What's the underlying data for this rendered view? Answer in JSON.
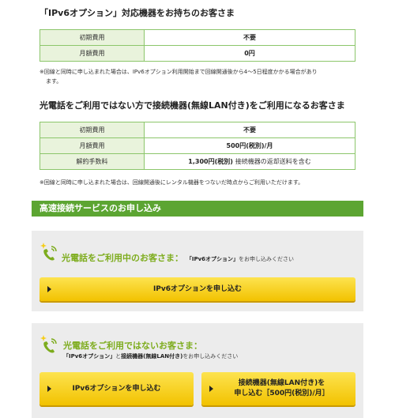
{
  "section1": {
    "title": "「IPv6オプション」対応機器をお持ちのお客さま",
    "rows": [
      {
        "label": "初期費用",
        "value": "不要"
      },
      {
        "label": "月額費用",
        "value": "0円"
      }
    ],
    "note_line1": "※回線と同時に申し込まれた場合は、IPv6オプション利用開始まで回線開通後から4～5日程度かかる場合があり",
    "note_line2": "ます。"
  },
  "section2": {
    "title": "光電話をご利用ではない方で接続機器(無線LAN付き)をご利用になるお客さま",
    "rows": [
      {
        "label": "初期費用",
        "value": "不要"
      },
      {
        "label": "月額費用",
        "value": "500円(税別)/月"
      },
      {
        "label": "解約手数料",
        "value": "1,300円(税別)",
        "value_sub": "接続機器の返却送料を含む"
      }
    ],
    "note": "※回線と同時に申し込まれた場合は、回線開通後にレンタル機器をつないだ時点からご利用いただけます。"
  },
  "apply_bar": "高速接続サービスのお申し込み",
  "card1": {
    "heading": "光電話をご利用中のお客さま：",
    "sub_bold": "「IPv6オプション」",
    "sub_rest": "をお申し込みください",
    "button": "IPv6オプションを申し込む"
  },
  "card2": {
    "heading": "光電話をご利用ではないお客さま：",
    "sub_bold1": "「IPv6オプション」",
    "sub_mid": "と",
    "sub_bold2": "接続機器(無線LAN付き)",
    "sub_rest": "をお申し込みください",
    "button1": "IPv6オプションを申し込む",
    "button2_line1": "接続機器(無線LAN付き)を",
    "button2_line2": "申し込む［500円(税別)/月］"
  },
  "colors": {
    "table_border": "#8cc66b",
    "label_bg": "#e9f3dc",
    "section_bar": "#5ca532",
    "heading_green": "#7dac1d",
    "button_yellow": "#f6cd14",
    "card_bg": "#ececec"
  },
  "icons": [
    "phone-sparkle-icon",
    "arrow-right-icon"
  ]
}
